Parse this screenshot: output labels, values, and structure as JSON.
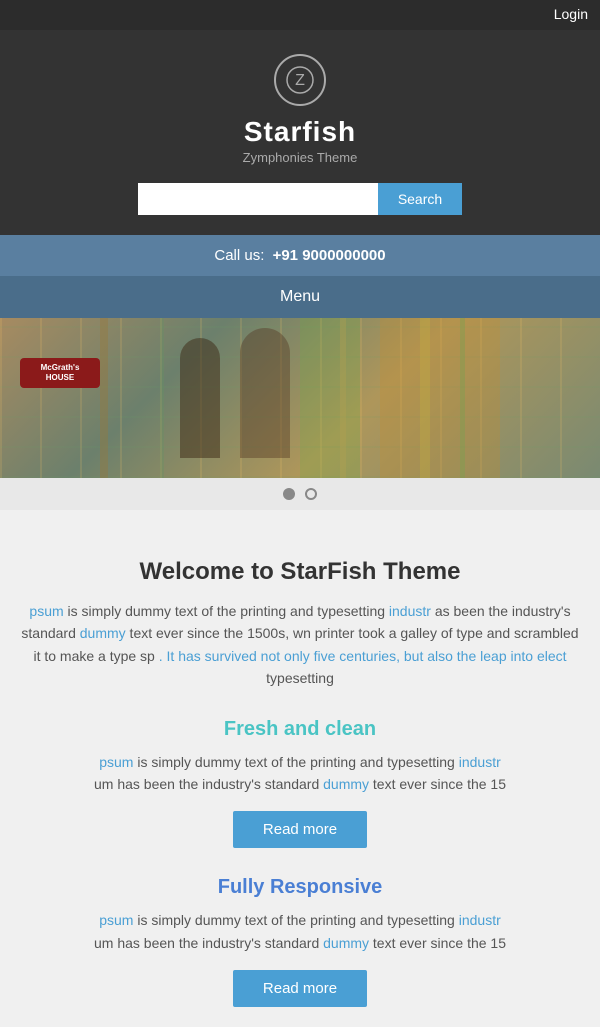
{
  "topbar": {
    "login_label": "Login"
  },
  "header": {
    "logo_alt": "Starfish logo",
    "logo_letter": "Z",
    "site_title": "Starfish",
    "site_subtitle": "Zymphonies Theme",
    "search_placeholder": "",
    "search_button_label": "Search"
  },
  "call_bar": {
    "label": "Call us:",
    "number": "+91 9000000000"
  },
  "menu_bar": {
    "label": "Menu"
  },
  "slider": {
    "sign_text": "McGrath's",
    "sign_subtext": "HOUSE"
  },
  "dots": [
    {
      "active": true
    },
    {
      "active": false
    }
  ],
  "welcome": {
    "title": "Welcome to StarFish Theme",
    "body": "psum is simply dummy text of the printing and typesetting industr as been the industry's standard dummy text ever since the 1500s, wn printer took a galley of type and scrambled it to make a type sp . It has survived not only five centuries, but also the leap into elect typesetting"
  },
  "features": [
    {
      "title": "Fresh and clean",
      "title_color": "cyan",
      "body": "psum is simply dummy text of the printing and typesetting industr um has been the industry's standard dummy text ever since the 15",
      "button_label": "Read more"
    },
    {
      "title": "Fully Responsive",
      "title_color": "blue",
      "body": "psum is simply dummy text of the printing and typesetting industr um has been the industry's standard dummy text ever since the 15",
      "button_label": "Read more"
    }
  ]
}
